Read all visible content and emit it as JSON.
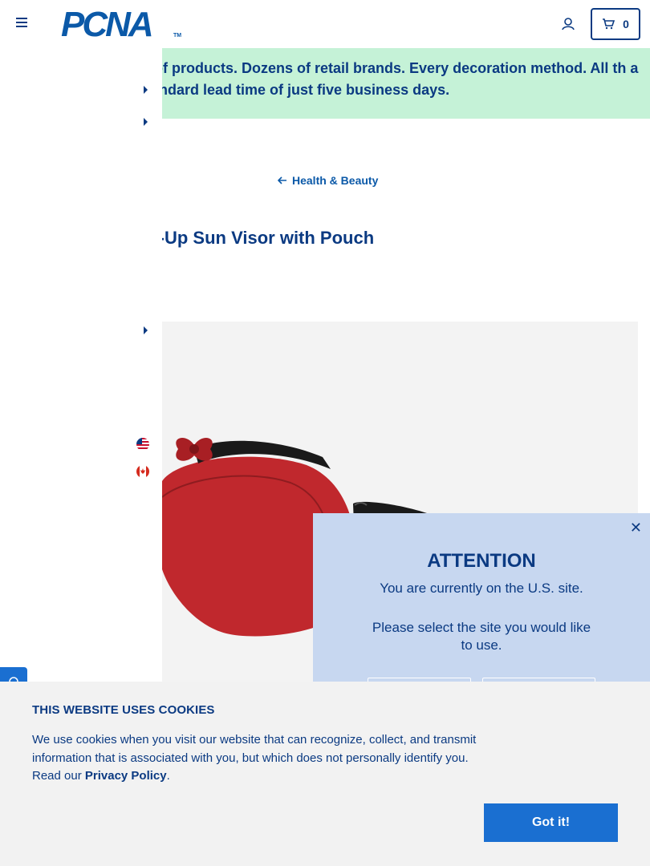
{
  "header": {
    "logo_text": "PCNA",
    "logo_tm": "TM",
    "cart_count": "0"
  },
  "promo": {
    "text": "ls of products. Dozens of retail brands. Every decoration method. All th a standard lead time of just five business days."
  },
  "breadcrumb": {
    "back_label": "Health & Beauty"
  },
  "product": {
    "title": "oll-Up Sun Visor with Pouch",
    "image_colors": {
      "visor": "#c0282d",
      "pouch": "#1a1a1a"
    }
  },
  "modal": {
    "title": "ATTENTION",
    "line1": "You are currently on the U.S. site.",
    "line2": "Please select the site you would like to use."
  },
  "cookie": {
    "title": "THIS WEBSITE USES COOKIES",
    "body": "We use cookies when you visit our website that can recognize, collect, and transmit information that is associated with you, but which does not personally identify you. Read our ",
    "link": "Privacy Policy",
    "tail": ".",
    "button": "Got it!"
  },
  "colors": {
    "brand_navy": "#0b3a82",
    "brand_blue": "#1a6fd1",
    "promo_bg": "#c5f2d7",
    "modal_bg": "#c7d7f0"
  },
  "icons": [
    "menu-icon",
    "account-icon",
    "cart-icon",
    "arrow-left-icon",
    "caret-right-icon",
    "us-flag-icon",
    "canada-flag-icon",
    "chat-icon",
    "close-icon"
  ]
}
